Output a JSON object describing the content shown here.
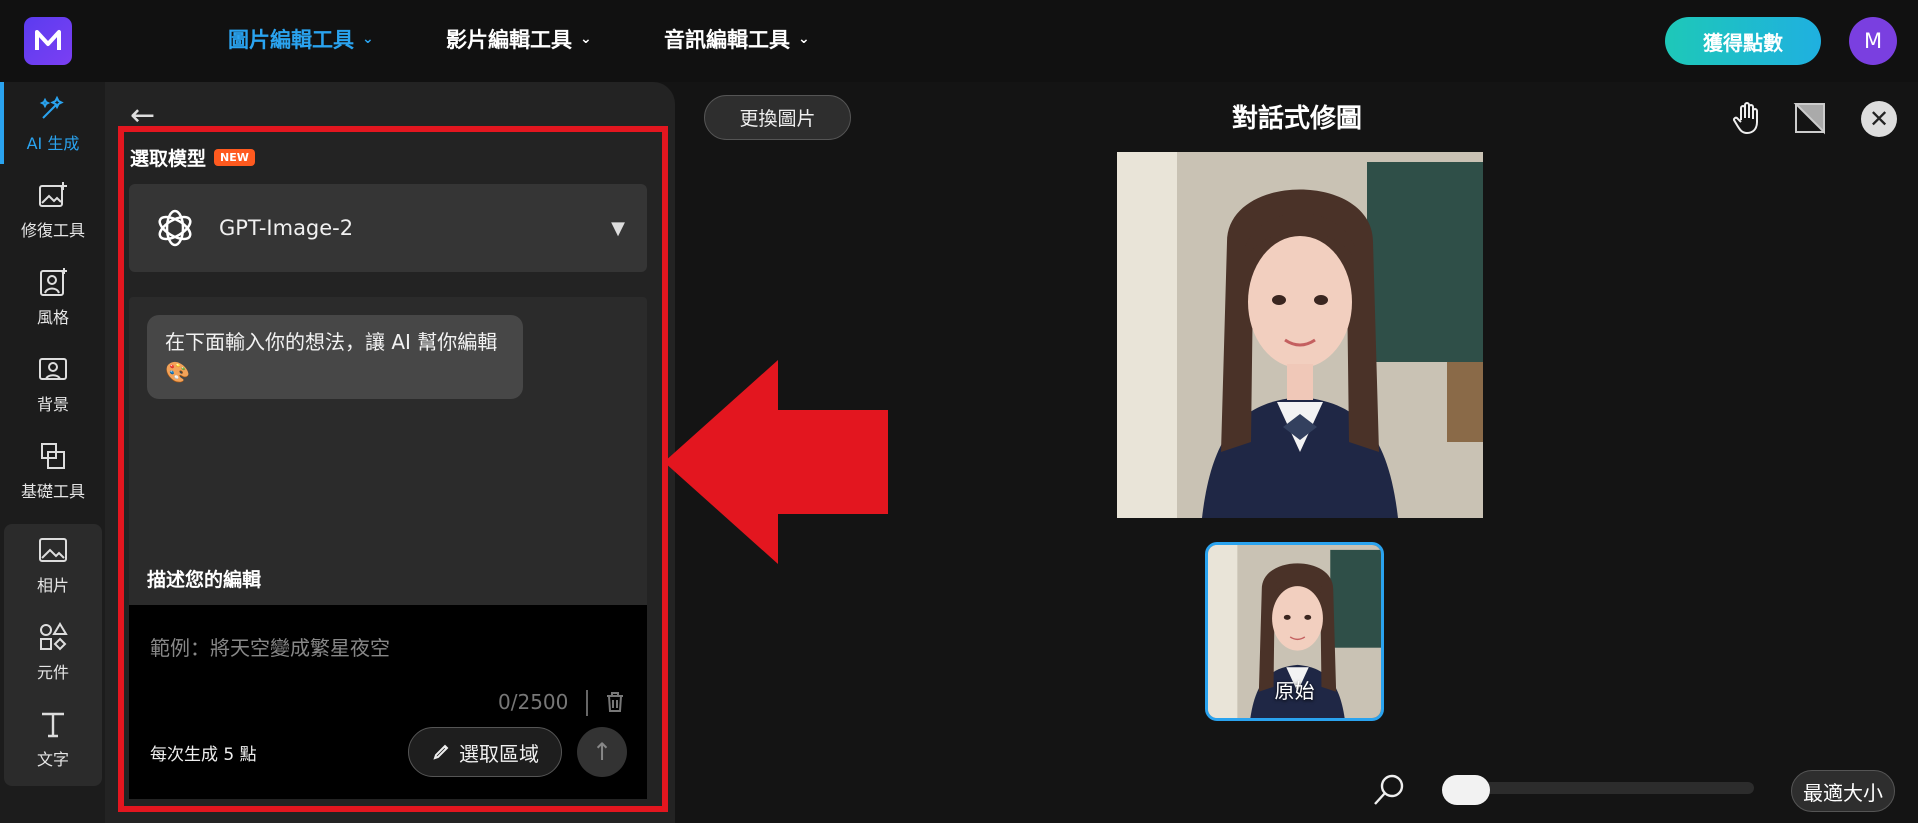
{
  "topnav": {
    "items": [
      {
        "label": "圖片編輯工具"
      },
      {
        "label": "影片編輯工具"
      },
      {
        "label": "音訊編輯工具"
      }
    ],
    "points_button": "獲得點數",
    "avatar_initial": "M"
  },
  "rail": {
    "items": [
      {
        "label": "AI 生成",
        "icon": "magic-wand-icon"
      },
      {
        "label": "修復工具",
        "icon": "image-enhance-icon"
      },
      {
        "label": "風格",
        "icon": "portrait-style-icon"
      },
      {
        "label": "背景",
        "icon": "background-icon"
      },
      {
        "label": "基礎工具",
        "icon": "crop-icon"
      },
      {
        "label": "相片",
        "icon": "photo-icon"
      },
      {
        "label": "元件",
        "icon": "shapes-icon"
      },
      {
        "label": "文字",
        "icon": "text-icon"
      }
    ]
  },
  "panel": {
    "model_section_title": "選取模型",
    "new_badge": "NEW",
    "model_name": "GPT-Image-2",
    "bubble_text": "在下面輸入你的想法，讓 AI 幫你編輯 🎨",
    "describe_title": "描述您的編輯",
    "input_placeholder": "範例：將天空變成繁星夜空",
    "input_value": "",
    "counter": "0/2500",
    "cost": "每次生成 5 點",
    "select_area": "選取區域"
  },
  "canvas": {
    "replace_button": "更換圖片",
    "title": "對話式修圖",
    "thumbnail_label": "原始",
    "fit_button": "最適大小",
    "zoom_level": 0.1
  },
  "colors": {
    "accent": "#2aa3ef",
    "highlight_frame": "#e3161f",
    "background": "#141414"
  }
}
